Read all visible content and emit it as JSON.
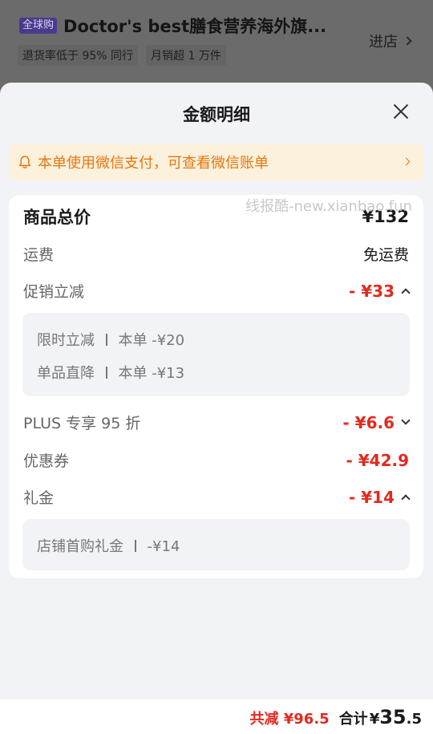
{
  "store": {
    "badge": "全球购",
    "name": "Doctor's best膳食营养海外旗...",
    "tags": [
      "退货率低于 95% 同行",
      "月销超 1 万件"
    ],
    "enter_label": "进店"
  },
  "sheet": {
    "title": "金额明细",
    "notice": "本单使用微信支付，可查看微信账单",
    "watermark": "线报酷-new.xianbao.fun"
  },
  "rows": {
    "goods_total": {
      "label": "商品总价",
      "value": "¥132"
    },
    "shipping": {
      "label": "运费",
      "value": "免运费"
    },
    "promo": {
      "label": "促销立减",
      "value": "- ¥33"
    },
    "plus": {
      "label": "PLUS 专享 95 折",
      "value": "- ¥6.6"
    },
    "coupon": {
      "label": "优惠券",
      "value": "- ¥42.9"
    },
    "gift": {
      "label": "礼金",
      "value": "- ¥14"
    }
  },
  "promo_details": [
    {
      "name": "限时立减",
      "desc": "本单 -¥20"
    },
    {
      "name": "单品直降",
      "desc": "本单 -¥13"
    }
  ],
  "gift_details": [
    {
      "name": "店铺首购礼金",
      "desc": "-¥14"
    }
  ],
  "footer": {
    "saved": "共减 ¥96.5",
    "total_label": "合计",
    "currency": "¥",
    "total_int": "35",
    "total_dec": ".5"
  },
  "colors": {
    "accent_red": "#e22a1f",
    "notice_orange": "#e8760f",
    "notice_bg": "#fcf1dc"
  }
}
